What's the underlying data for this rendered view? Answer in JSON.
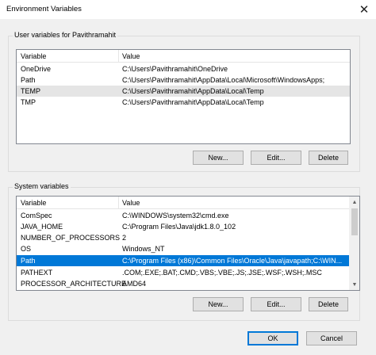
{
  "window": {
    "title": "Environment Variables",
    "close_glyph": "✕"
  },
  "user_vars": {
    "group_label": "User variables for Pavithramahit",
    "columns": [
      "Variable",
      "Value"
    ],
    "rows": [
      {
        "variable": "OneDrive",
        "value": "C:\\Users\\Pavithramahit\\OneDrive"
      },
      {
        "variable": "Path",
        "value": "C:\\Users\\Pavithramahit\\AppData\\Local\\Microsoft\\WindowsApps;"
      },
      {
        "variable": "TEMP",
        "value": "C:\\Users\\Pavithramahit\\AppData\\Local\\Temp"
      },
      {
        "variable": "TMP",
        "value": "C:\\Users\\Pavithramahit\\AppData\\Local\\Temp"
      }
    ],
    "buttons": {
      "new": "New...",
      "edit": "Edit...",
      "delete": "Delete"
    }
  },
  "system_vars": {
    "group_label": "System variables",
    "columns": [
      "Variable",
      "Value"
    ],
    "rows": [
      {
        "variable": "ComSpec",
        "value": "C:\\WINDOWS\\system32\\cmd.exe"
      },
      {
        "variable": "JAVA_HOME",
        "value": "C:\\Program Files\\Java\\jdk1.8.0_102"
      },
      {
        "variable": "NUMBER_OF_PROCESSORS",
        "value": "2"
      },
      {
        "variable": "OS",
        "value": "Windows_NT"
      },
      {
        "variable": "Path",
        "value": "C:\\Program Files (x86)\\Common Files\\Oracle\\Java\\javapath;C:\\WIN..."
      },
      {
        "variable": "PATHEXT",
        "value": ".COM;.EXE;.BAT;.CMD;.VBS;.VBE;.JS;.JSE;.WSF;.WSH;.MSC"
      },
      {
        "variable": "PROCESSOR_ARCHITECTURE",
        "value": "AMD64"
      }
    ],
    "buttons": {
      "new": "New...",
      "edit": "Edit...",
      "delete": "Delete"
    }
  },
  "dialog_buttons": {
    "ok": "OK",
    "cancel": "Cancel"
  },
  "colors": {
    "selection": "#0078d7",
    "hover_row": "#e5e5e5"
  }
}
